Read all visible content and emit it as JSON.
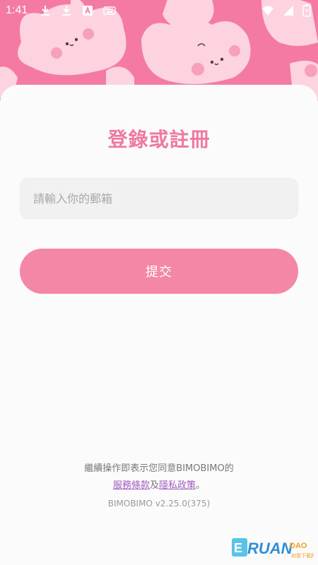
{
  "status_bar": {
    "time": "1:41",
    "left_icons": [
      "download-icon",
      "download-icon",
      "text-a-icon",
      "keyboard-icon"
    ],
    "right_icons": [
      "wifi-icon",
      "signal-icon",
      "battery-charging-icon"
    ]
  },
  "colors": {
    "accent": "#f587a6",
    "title": "#ee7a9f",
    "header_bg": "#f47aa4",
    "card_bg": "#fbfbfb",
    "link": "#a05cc0"
  },
  "auth": {
    "title": "登錄或註冊",
    "email_placeholder": "請輸入你的郵箱",
    "email_value": "",
    "submit_label": "提交"
  },
  "footer": {
    "agreement_text": "繼續操作即表示您同意BIMOBIMO的",
    "terms_link": "服務條款",
    "and_text": "及",
    "privacy_link": "隱私政策",
    "period": "。",
    "version": "BIMOBIMO v2.25.0(375)"
  },
  "watermark": {
    "text": "RUANDAO",
    "subtext": "如意下载网"
  }
}
